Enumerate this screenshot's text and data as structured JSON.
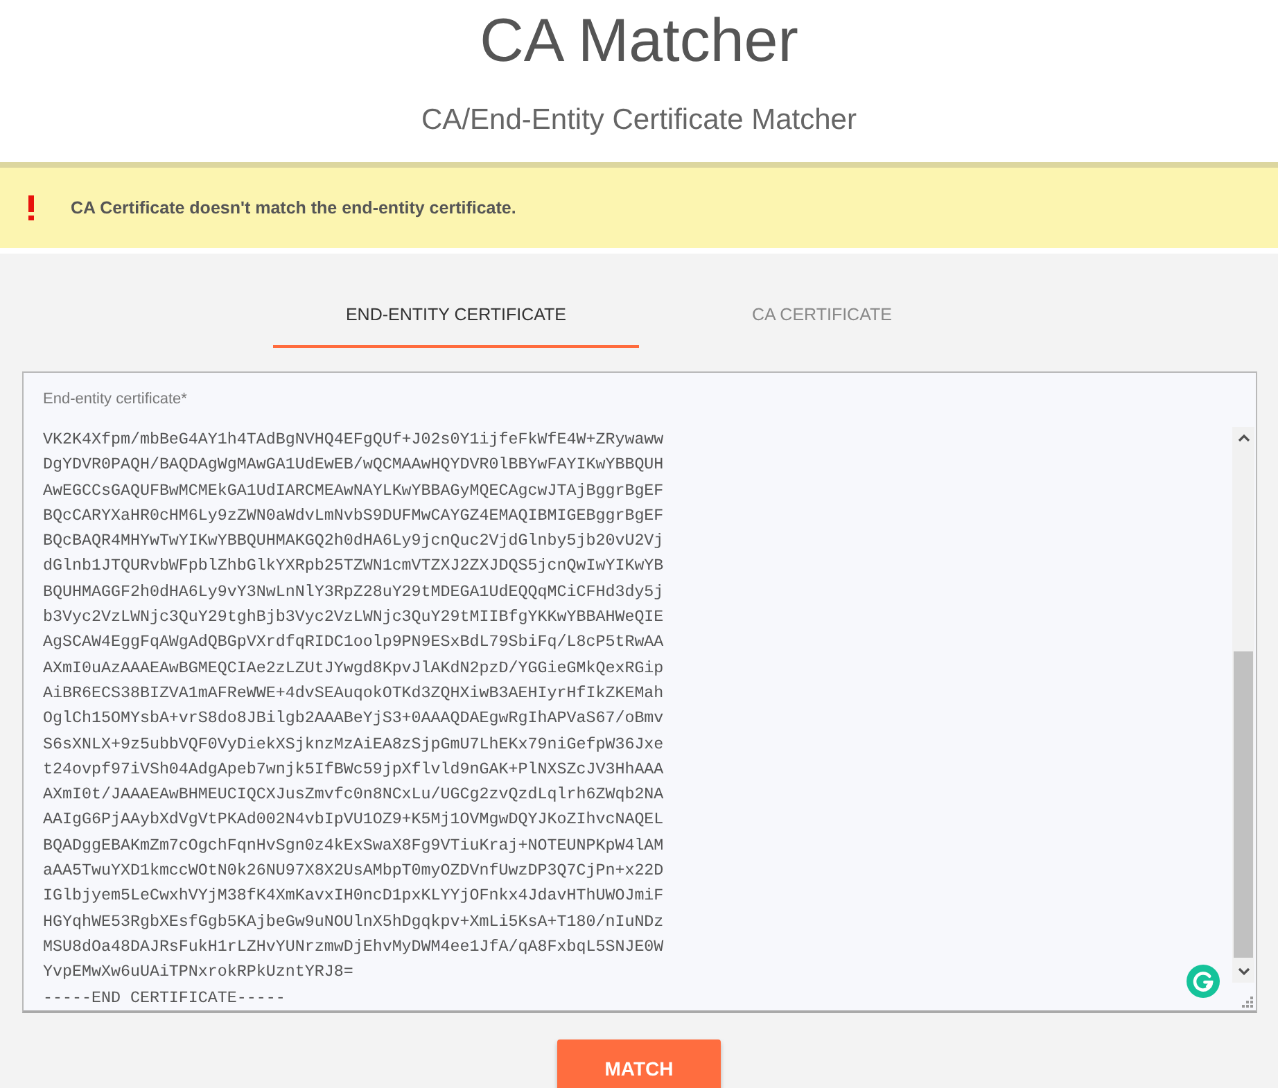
{
  "header": {
    "title": "CA Matcher",
    "subtitle": "CA/End-Entity Certificate Matcher"
  },
  "alert": {
    "message": "CA Certificate doesn't match the end-entity certificate."
  },
  "tabs": [
    {
      "label": "END-ENTITY CERTIFICATE",
      "selected": true
    },
    {
      "label": "CA CERTIFICATE",
      "selected": false
    }
  ],
  "certificate_field": {
    "label": "End-entity certificate*",
    "value_lines": [
      "VK2K4Xfpm/mbBeG4AY1h4TAdBgNVHQ4EFgQUf+J02s0Y1ijfeFkWfE4W+ZRywaww",
      "DgYDVR0PAQH/BAQDAgWgMAwGA1UdEwEB/wQCMAAwHQYDVR0lBBYwFAYIKwYBBQUH",
      "AwEGCCsGAQUFBwMCMEkGA1UdIARCMEAwNAYLKwYBBAGyMQECAgcwJTAjBggrBgEF",
      "BQcCARYXaHR0cHM6Ly9zZWN0aWdvLmNvbS9DUFMwCAYGZ4EMAQIBMIGEBggrBgEF",
      "BQcBAQR4MHYwTwYIKwYBBQUHMAKGQ2h0dHA6Ly9jcnQuc2VjdGlnby5jb20vU2Vj",
      "dGlnb1JTQURvbWFpblZhbGlkYXRpb25TZWN1cmVTZXJ2ZXJDQS5jcnQwIwYIKwYB",
      "BQUHMAGGF2h0dHA6Ly9vY3NwLnNlY3RpZ28uY29tMDEGA1UdEQQqMCiCFHd3dy5j",
      "b3Vyc2VzLWNjc3QuY29tghBjb3Vyc2VzLWNjc3QuY29tMIIBfgYKKwYBBAHWeQIE",
      "AgSCAW4EggFqAWgAdQBGpVXrdfqRIDC1oolp9PN9ESxBdL79SbiFq/L8cP5tRwAA",
      "AXmI0uAzAAAEAwBGMEQCIAe2zLZUtJYwgd8KpvJlAKdN2pzD/YGGieGMkQexRGip",
      "AiBR6ECS38BIZVA1mAFReWWE+4dvSEAuqokOTKd3ZQHXiwB3AEHIyrHfIkZKEMah",
      "OglCh15OMYsbA+vrS8do8JBilgb2AAABeYjS3+0AAAQDAEgwRgIhAPVaS67/oBmv",
      "S6sXNLX+9z5ubbVQF0VyDiekXSjknzMzAiEA8zSjpGmU7LhEKx79niGefpW36Jxe",
      "t24ovpf97iVSh04AdgApeb7wnjk5IfBWc59jpXflvld9nGAK+PlNXSZcJV3HhAAA",
      "AXmI0t/JAAAEAwBHMEUCIQCXJusZmvfc0n8NCxLu/UGCg2zvQzdLqlrh6ZWqb2NA",
      "AAIgG6PjAAybXdVgVtPKAd002N4vbIpVU1OZ9+K5Mj1OVMgwDQYJKoZIhvcNAQEL",
      "BQADggEBAKmZm7cOgchFqnHvSgn0z4kExSwaX8Fg9VTiuKraj+NOTEUNPKpW4lAM",
      "aAA5TwuYXD1kmccWOtN0k26NU97X8X2UsAMbpT0myOZDVnfUwzDP3Q7CjPn+x22D",
      "IGlbjyem5LeCwxhVYjM38fK4XmKavxIH0ncD1pxKLYYjOFnkx4JdavHThUWOJmiF",
      "HGYqhWE53RgbXEsfGgb5KAjbeGw9uNOUlnX5hDgqkpv+XmLi5KsA+T180/nIuNDz",
      "MSU8dOa48DAJRsFukH1rLZHvYUNrzmwDjEhvMyDWM4ee1JfA/qA8FxbqL5SNJE0W",
      "YvpEMwXw6uUAiTPNxrokRPkUzntYRJ8=",
      "-----END CERTIFICATE-----"
    ]
  },
  "buttons": [
    {
      "label": "MATCH"
    }
  ]
}
